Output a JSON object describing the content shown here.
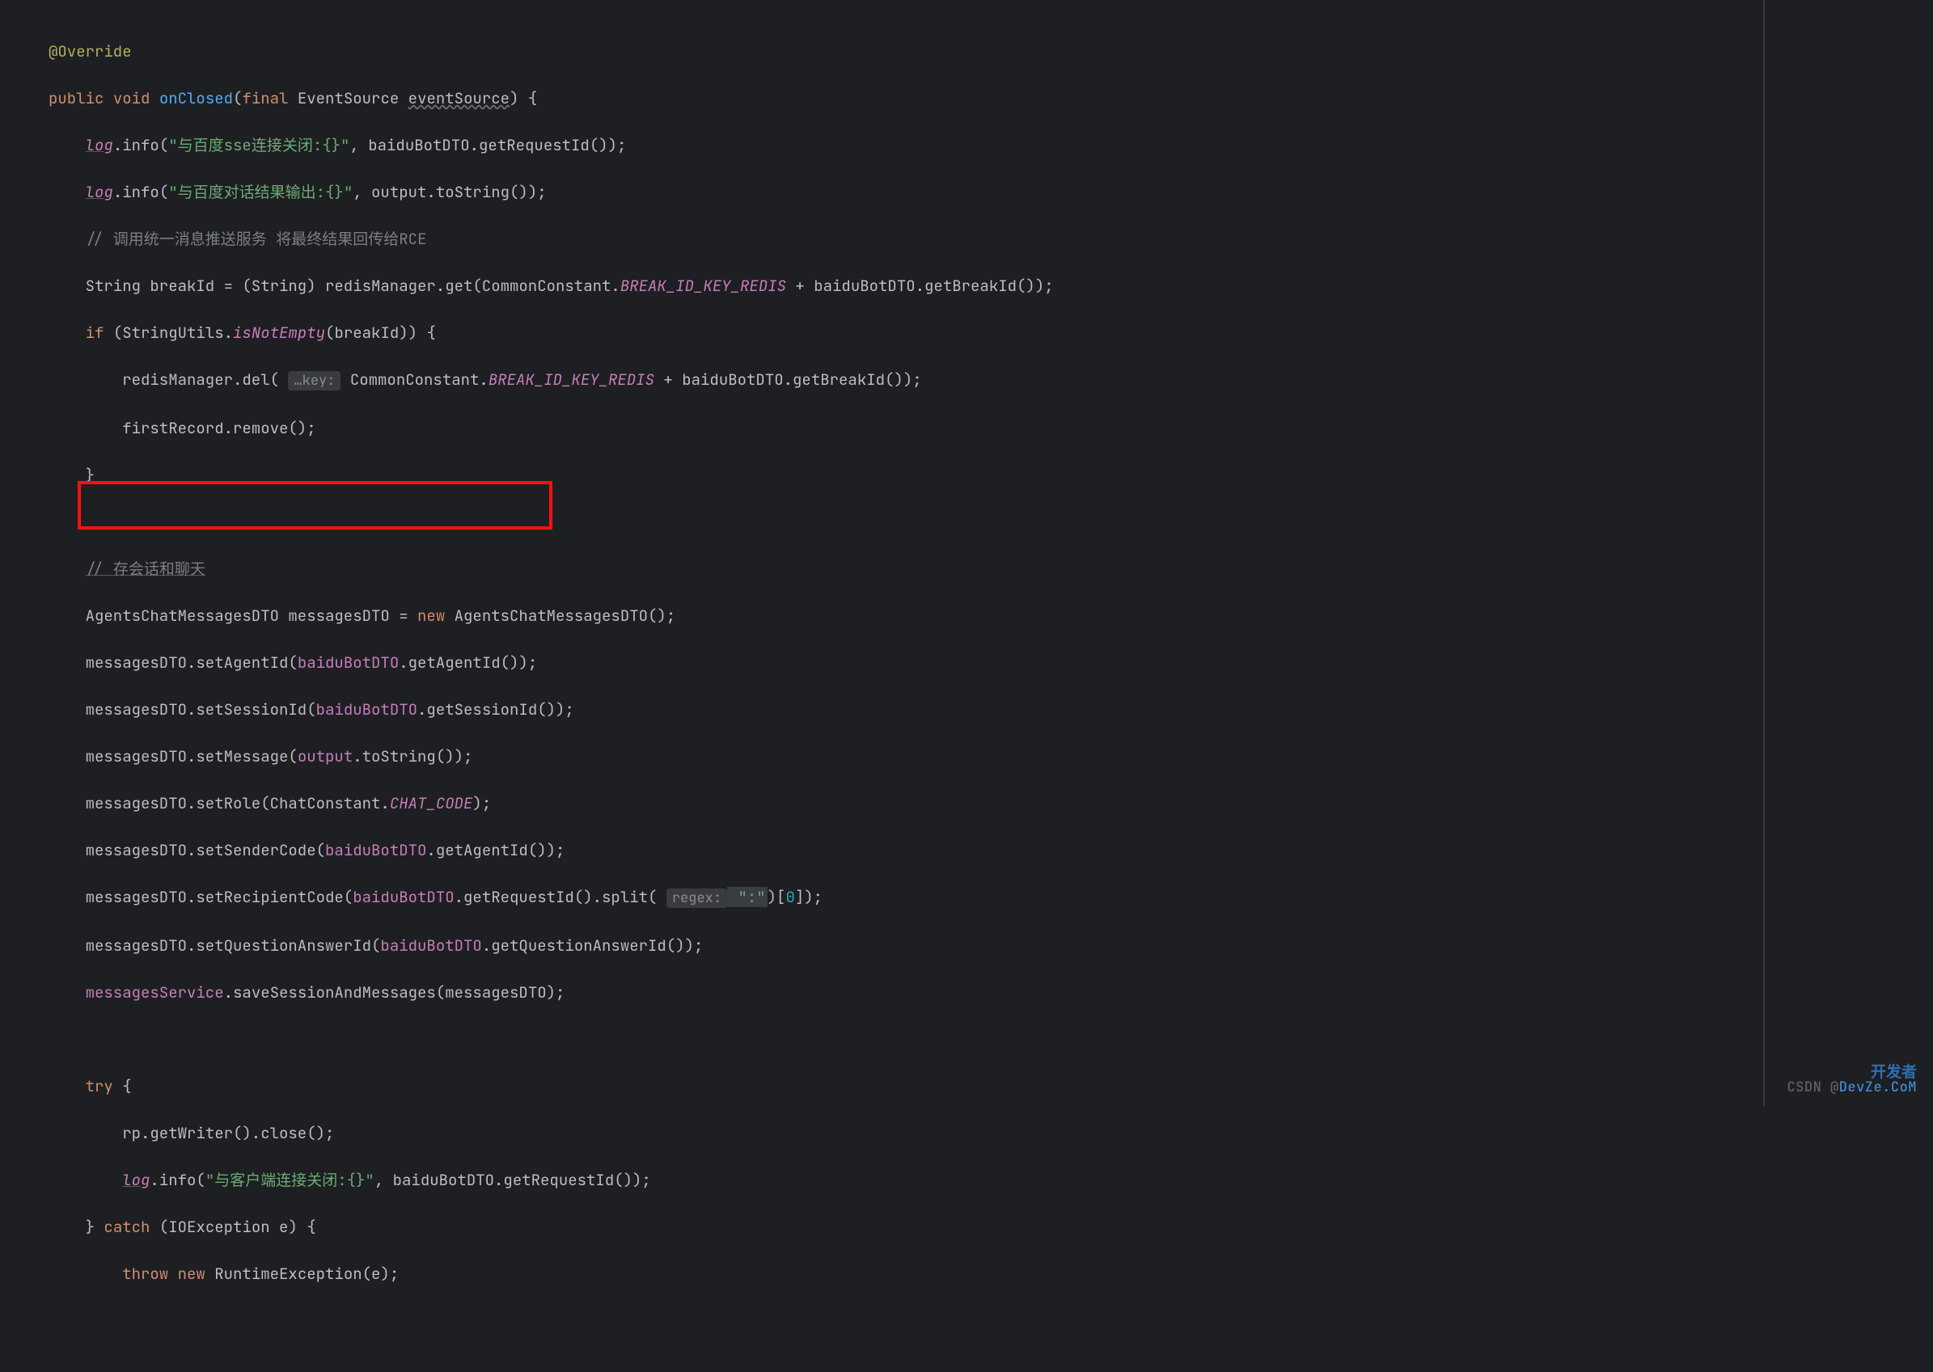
{
  "code": {
    "annotation_override": "@Override",
    "onclosed_sig": {
      "public": "public",
      "void": "void",
      "name": "onClosed",
      "final": "final",
      "type": "EventSource",
      "param": "eventSource",
      "brace": ") {"
    },
    "log_info1": {
      "var": "log",
      "m": ".info(",
      "s": "\"与百度sse连接关闭:{}\"",
      "c": ", baiduBotDTO.getRequestId());"
    },
    "log_info2": {
      "var": "log",
      "m": ".info(",
      "s": "\"与百度对话结果输出:{}\"",
      "c": ", output.toString());"
    },
    "comment1": "// 调用统一消息推送服务 将最终结果回传给RCE",
    "breakid_line": {
      "a": "String breakId = (String) redisManager.get(CommonConstant.",
      "c1": "BREAK_ID_KEY_REDIS",
      "b": " + baiduBotDTO.getBreakId());"
    },
    "if_line": {
      "kw": "if",
      "a": " (StringUtils.",
      "m": "isNotEmpty",
      "b": "(breakId)) {"
    },
    "del_line": {
      "a": "redisManager.del(",
      "hint": "…key:",
      "b": " CommonConstant.",
      "c": "BREAK_ID_KEY_REDIS",
      "d": " + baiduBotDTO.getBreakId());"
    },
    "first_remove": "firstRecord.remove();",
    "close_brace1": "}",
    "comment2_a": "//",
    "comment2_b": " 存会话和聊天",
    "new_dto": {
      "a": "AgentsChatMessagesDTO messagesDTO = ",
      "kw": "new",
      "b": " AgentsChatMessagesDTO();"
    },
    "set_agent": "messagesDTO.setAgentId(",
    "set_agent_p": "baiduBotDTO",
    "set_agent_b": ".getAgentId());",
    "set_session": "messagesDTO.setSessionId(",
    "set_session_p": "baiduBotDTO",
    "set_session_b": ".getSessionId());",
    "set_msg": "messagesDTO.setMessage(",
    "set_msg_p": "output",
    "set_msg_b": ".toString());",
    "set_role_a": "messagesDTO.setRole(ChatConstant.",
    "set_role_c": "CHAT_CODE",
    "set_role_b": ");",
    "set_sender": "messagesDTO.setSenderCode(",
    "set_sender_p": "baiduBotDTO",
    "set_sender_b": ".getAgentId());",
    "set_recip": {
      "a": "messagesDTO.setRecipientCode(",
      "p": "baiduBotDTO",
      "b": ".getRequestId().split(",
      "hint": "regex:",
      "s": " \":\"",
      "c": ")[",
      "n": "0",
      "d": "]);"
    },
    "set_qa": "messagesDTO.setQuestionAnswerId(",
    "set_qa_p": "baiduBotDTO",
    "set_qa_b": ".getQuestionAnswerId());",
    "save_line": {
      "a": "messagesService",
      "b": ".saveSessionAndMessages(messagesDTO);"
    },
    "try_kw": "try",
    "try_brace": " {",
    "rp_close": "rp.getWriter().close();",
    "log_info3": {
      "var": "log",
      "m": ".info(",
      "s": "\"与客户端连接关闭:{}\"",
      "c": ", baiduBotDTO.getRequestId());"
    },
    "catch": {
      "a": "} ",
      "kw": "catch",
      "b": " (IOException e) {"
    },
    "throw": {
      "kw1": "throw",
      "sp": " ",
      "kw2": "new",
      "b": " RuntimeException(e);"
    }
  },
  "watermark": {
    "csdn": "CSDN @",
    "devze": "DevZe.CoM",
    "cn": "开发者"
  }
}
